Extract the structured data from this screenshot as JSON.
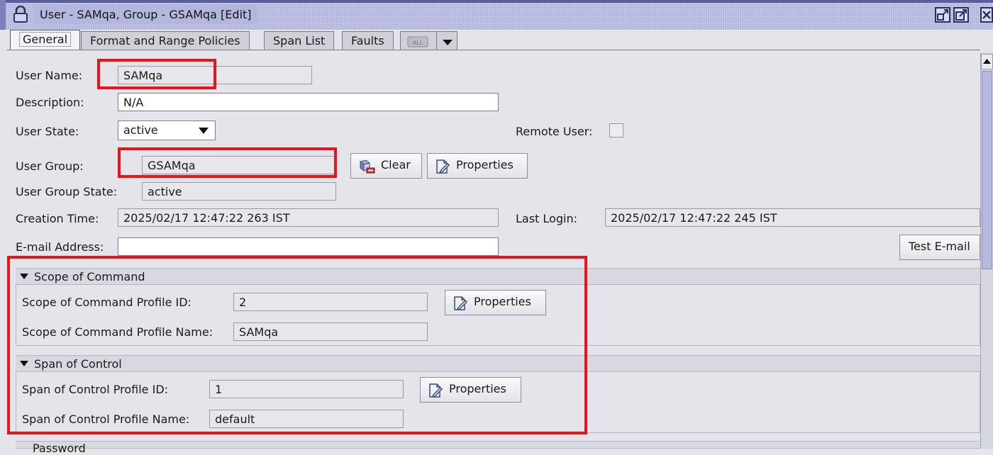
{
  "window": {
    "title": "User - SAMqa, Group - GSAMqa [Edit]"
  },
  "tabs": [
    {
      "label": "General",
      "active": true
    },
    {
      "label": "Format and Range Policies",
      "active": false
    },
    {
      "label": "Span List",
      "active": false
    },
    {
      "label": "Faults",
      "active": false
    }
  ],
  "tab_overflow_icon": "all-tabs-icon",
  "form": {
    "user_name": {
      "label": "User Name:",
      "value": "SAMqa"
    },
    "description": {
      "label": "Description:",
      "value": "N/A"
    },
    "user_state": {
      "label": "User State:",
      "value": "active"
    },
    "remote_user": {
      "label": "Remote User:",
      "checked": false
    },
    "user_group": {
      "label": "User Group:",
      "value": "GSAMqa"
    },
    "clear_button": "Clear",
    "properties_button": "Properties",
    "user_group_state": {
      "label": "User Group State:",
      "value": "active"
    },
    "creation_time": {
      "label": "Creation Time:",
      "value": "2025/02/17 12:47:22 263 IST"
    },
    "last_login": {
      "label": "Last Login:",
      "value": "2025/02/17 12:47:22 245 IST"
    },
    "email": {
      "label": "E-mail Address:",
      "value": ""
    },
    "test_email_button": "Test E-mail"
  },
  "scope_of_command": {
    "title": "Scope of Command",
    "profile_id": {
      "label": "Scope of Command Profile ID:",
      "value": "2"
    },
    "profile_name": {
      "label": "Scope of Command Profile Name:",
      "value": "SAMqa"
    },
    "properties_button": "Properties"
  },
  "span_of_control": {
    "title": "Span of Control",
    "profile_id": {
      "label": "Span of Control Profile ID:",
      "value": "1"
    },
    "profile_name": {
      "label": "Span of Control Profile Name:",
      "value": "default"
    },
    "properties_button": "Properties"
  },
  "next_section": {
    "title": "Password"
  },
  "colors": {
    "highlight": "#e8141a",
    "title_bar": "#a9add7"
  }
}
